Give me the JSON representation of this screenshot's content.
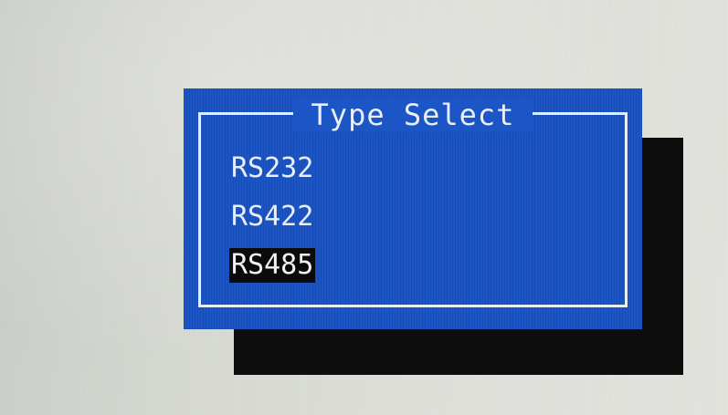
{
  "dialog": {
    "title": "Type Select",
    "options": [
      {
        "label": "RS232",
        "selected": false
      },
      {
        "label": "RS422",
        "selected": false
      },
      {
        "label": "RS485",
        "selected": true
      }
    ],
    "selected_label": "RS485"
  },
  "colors": {
    "dialog_background": "#1c55c6",
    "text": "#e9eef7",
    "selection_background": "#0b0b0b",
    "shadow": "#0d0d0d",
    "screen_background": "#d6d8d2"
  }
}
